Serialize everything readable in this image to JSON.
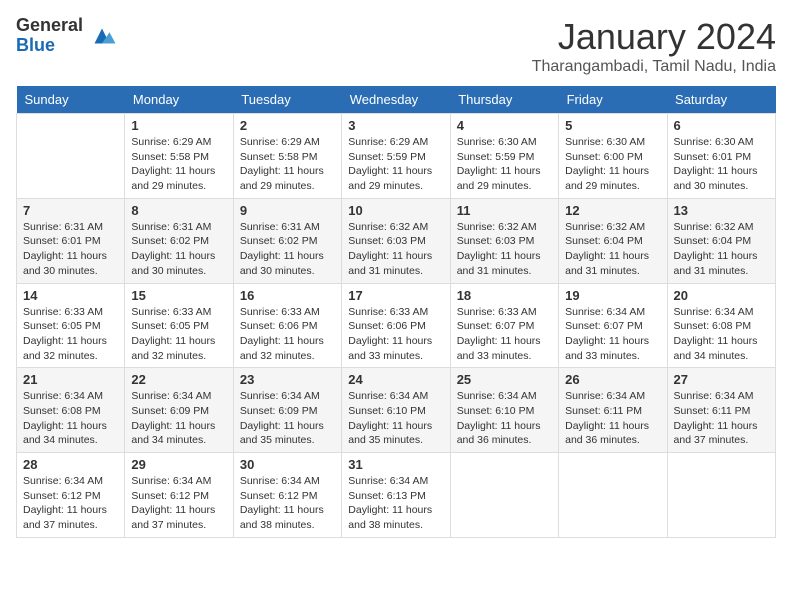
{
  "header": {
    "logo_general": "General",
    "logo_blue": "Blue",
    "month_title": "January 2024",
    "location": "Tharangambadi, Tamil Nadu, India"
  },
  "weekdays": [
    "Sunday",
    "Monday",
    "Tuesday",
    "Wednesday",
    "Thursday",
    "Friday",
    "Saturday"
  ],
  "weeks": [
    [
      {
        "day": "",
        "info": ""
      },
      {
        "day": "1",
        "info": "Sunrise: 6:29 AM\nSunset: 5:58 PM\nDaylight: 11 hours\nand 29 minutes."
      },
      {
        "day": "2",
        "info": "Sunrise: 6:29 AM\nSunset: 5:58 PM\nDaylight: 11 hours\nand 29 minutes."
      },
      {
        "day": "3",
        "info": "Sunrise: 6:29 AM\nSunset: 5:59 PM\nDaylight: 11 hours\nand 29 minutes."
      },
      {
        "day": "4",
        "info": "Sunrise: 6:30 AM\nSunset: 5:59 PM\nDaylight: 11 hours\nand 29 minutes."
      },
      {
        "day": "5",
        "info": "Sunrise: 6:30 AM\nSunset: 6:00 PM\nDaylight: 11 hours\nand 29 minutes."
      },
      {
        "day": "6",
        "info": "Sunrise: 6:30 AM\nSunset: 6:01 PM\nDaylight: 11 hours\nand 30 minutes."
      }
    ],
    [
      {
        "day": "7",
        "info": "Sunrise: 6:31 AM\nSunset: 6:01 PM\nDaylight: 11 hours\nand 30 minutes."
      },
      {
        "day": "8",
        "info": "Sunrise: 6:31 AM\nSunset: 6:02 PM\nDaylight: 11 hours\nand 30 minutes."
      },
      {
        "day": "9",
        "info": "Sunrise: 6:31 AM\nSunset: 6:02 PM\nDaylight: 11 hours\nand 30 minutes."
      },
      {
        "day": "10",
        "info": "Sunrise: 6:32 AM\nSunset: 6:03 PM\nDaylight: 11 hours\nand 31 minutes."
      },
      {
        "day": "11",
        "info": "Sunrise: 6:32 AM\nSunset: 6:03 PM\nDaylight: 11 hours\nand 31 minutes."
      },
      {
        "day": "12",
        "info": "Sunrise: 6:32 AM\nSunset: 6:04 PM\nDaylight: 11 hours\nand 31 minutes."
      },
      {
        "day": "13",
        "info": "Sunrise: 6:32 AM\nSunset: 6:04 PM\nDaylight: 11 hours\nand 31 minutes."
      }
    ],
    [
      {
        "day": "14",
        "info": "Sunrise: 6:33 AM\nSunset: 6:05 PM\nDaylight: 11 hours\nand 32 minutes."
      },
      {
        "day": "15",
        "info": "Sunrise: 6:33 AM\nSunset: 6:05 PM\nDaylight: 11 hours\nand 32 minutes."
      },
      {
        "day": "16",
        "info": "Sunrise: 6:33 AM\nSunset: 6:06 PM\nDaylight: 11 hours\nand 32 minutes."
      },
      {
        "day": "17",
        "info": "Sunrise: 6:33 AM\nSunset: 6:06 PM\nDaylight: 11 hours\nand 33 minutes."
      },
      {
        "day": "18",
        "info": "Sunrise: 6:33 AM\nSunset: 6:07 PM\nDaylight: 11 hours\nand 33 minutes."
      },
      {
        "day": "19",
        "info": "Sunrise: 6:34 AM\nSunset: 6:07 PM\nDaylight: 11 hours\nand 33 minutes."
      },
      {
        "day": "20",
        "info": "Sunrise: 6:34 AM\nSunset: 6:08 PM\nDaylight: 11 hours\nand 34 minutes."
      }
    ],
    [
      {
        "day": "21",
        "info": "Sunrise: 6:34 AM\nSunset: 6:08 PM\nDaylight: 11 hours\nand 34 minutes."
      },
      {
        "day": "22",
        "info": "Sunrise: 6:34 AM\nSunset: 6:09 PM\nDaylight: 11 hours\nand 34 minutes."
      },
      {
        "day": "23",
        "info": "Sunrise: 6:34 AM\nSunset: 6:09 PM\nDaylight: 11 hours\nand 35 minutes."
      },
      {
        "day": "24",
        "info": "Sunrise: 6:34 AM\nSunset: 6:10 PM\nDaylight: 11 hours\nand 35 minutes."
      },
      {
        "day": "25",
        "info": "Sunrise: 6:34 AM\nSunset: 6:10 PM\nDaylight: 11 hours\nand 36 minutes."
      },
      {
        "day": "26",
        "info": "Sunrise: 6:34 AM\nSunset: 6:11 PM\nDaylight: 11 hours\nand 36 minutes."
      },
      {
        "day": "27",
        "info": "Sunrise: 6:34 AM\nSunset: 6:11 PM\nDaylight: 11 hours\nand 37 minutes."
      }
    ],
    [
      {
        "day": "28",
        "info": "Sunrise: 6:34 AM\nSunset: 6:12 PM\nDaylight: 11 hours\nand 37 minutes."
      },
      {
        "day": "29",
        "info": "Sunrise: 6:34 AM\nSunset: 6:12 PM\nDaylight: 11 hours\nand 37 minutes."
      },
      {
        "day": "30",
        "info": "Sunrise: 6:34 AM\nSunset: 6:12 PM\nDaylight: 11 hours\nand 38 minutes."
      },
      {
        "day": "31",
        "info": "Sunrise: 6:34 AM\nSunset: 6:13 PM\nDaylight: 11 hours\nand 38 minutes."
      },
      {
        "day": "",
        "info": ""
      },
      {
        "day": "",
        "info": ""
      },
      {
        "day": "",
        "info": ""
      }
    ]
  ]
}
